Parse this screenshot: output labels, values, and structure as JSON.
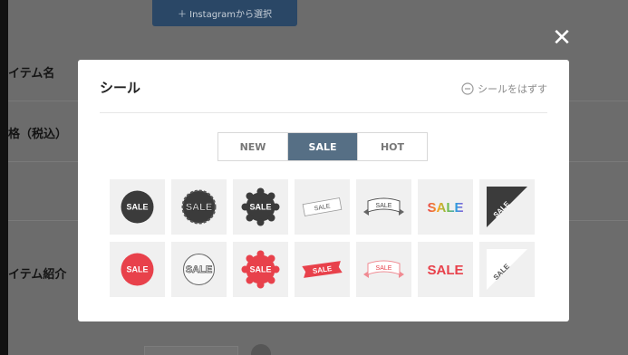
{
  "background": {
    "instagram_button_label": "＋ Instagramから選択",
    "rows": [
      "イテム名",
      "格（税込）",
      "",
      "イテム紹介"
    ]
  },
  "modal": {
    "title": "シール",
    "remove_label": "シールをはずす",
    "tabs": [
      {
        "label": "NEW",
        "active": false
      },
      {
        "label": "SALE",
        "active": true
      },
      {
        "label": "HOT",
        "active": false
      }
    ],
    "sticker_text": "SALE",
    "stickers": [
      {
        "name": "sticker-dark-circle",
        "style": "dark-circle"
      },
      {
        "name": "sticker-dark-rough-circle",
        "style": "dark-rough"
      },
      {
        "name": "sticker-dark-scalloped",
        "style": "dark-scallop"
      },
      {
        "name": "sticker-white-ribbon",
        "style": "white-ribbon"
      },
      {
        "name": "sticker-vintage-banner",
        "style": "vintage-banner"
      },
      {
        "name": "sticker-rainbow-text",
        "style": "rainbow-text"
      },
      {
        "name": "sticker-dark-corner",
        "style": "dark-corner"
      },
      {
        "name": "sticker-red-circle",
        "style": "red-circle"
      },
      {
        "name": "sticker-outline-circle",
        "style": "outline-circle"
      },
      {
        "name": "sticker-red-scalloped",
        "style": "red-scallop"
      },
      {
        "name": "sticker-red-ribbon",
        "style": "red-ribbon"
      },
      {
        "name": "sticker-pink-banner",
        "style": "pink-banner"
      },
      {
        "name": "sticker-red-text",
        "style": "red-text"
      },
      {
        "name": "sticker-white-corner",
        "style": "white-corner"
      }
    ]
  },
  "colors": {
    "accent_tab": "#566f85",
    "sale_red": "#e8414b",
    "sale_dark": "#3b3b3b"
  },
  "icons": {
    "close": "close-icon",
    "remove": "minus-circle-icon"
  }
}
